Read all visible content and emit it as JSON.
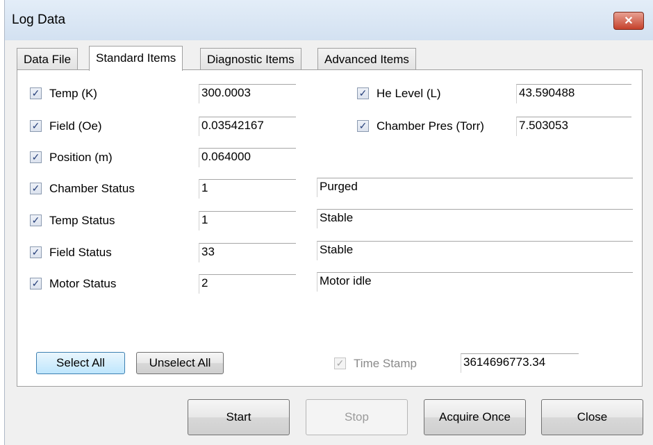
{
  "window": {
    "title": "Log Data",
    "close_label": "✕"
  },
  "tabs": [
    {
      "label": "Data File",
      "active": false
    },
    {
      "label": "Standard Items",
      "active": true
    },
    {
      "label": "Diagnostic Items",
      "active": false
    },
    {
      "label": "Advanced Items",
      "active": false
    }
  ],
  "items": {
    "temp": {
      "label": "Temp (K)",
      "checked": true,
      "value": "300.0003"
    },
    "field": {
      "label": "Field (Oe)",
      "checked": true,
      "value": "0.03542167"
    },
    "position": {
      "label": "Position (m)",
      "checked": true,
      "value": "0.064000"
    },
    "chamber_status": {
      "label": "Chamber Status",
      "checked": true,
      "value": "1",
      "text": "Purged"
    },
    "temp_status": {
      "label": "Temp Status",
      "checked": true,
      "value": "1",
      "text": "Stable"
    },
    "field_status": {
      "label": "Field Status",
      "checked": true,
      "value": "33",
      "text": "Stable"
    },
    "motor_status": {
      "label": "Motor Status",
      "checked": true,
      "value": "2",
      "text": "Motor idle"
    },
    "he_level": {
      "label": "He Level (L)",
      "checked": true,
      "value": "43.590488"
    },
    "chamber_pres": {
      "label": "Chamber Pres (Torr)",
      "checked": true,
      "value": "7.503053"
    }
  },
  "select_all_label": "Select All",
  "unselect_all_label": "Unselect All",
  "time_stamp": {
    "label": "Time Stamp",
    "checked": true,
    "enabled": false,
    "value": "3614696773.34"
  },
  "footer": {
    "start_label": "Start",
    "stop_label": "Stop",
    "acquire_once_label": "Acquire Once",
    "close_label": "Close"
  },
  "check_glyph": "✓"
}
